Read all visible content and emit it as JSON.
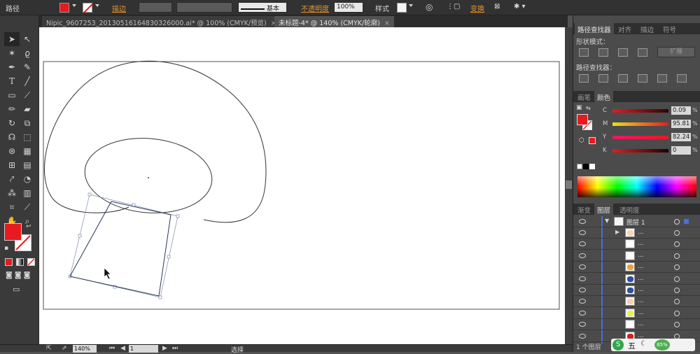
{
  "control_bar": {
    "selection_type": "路径",
    "stroke_label": "描边",
    "stroke_profile": "基本",
    "opacity_label": "不透明度",
    "opacity_value": "100%",
    "style_label": "样式",
    "transform_label": "变换",
    "fill_color": "#e8191f"
  },
  "document_tabs": [
    {
      "title": "Nipic_9607253_20130516164830326000.ai* @ 100% (CMYK/预览)",
      "close": "×"
    },
    {
      "title": "未标题-4* @ 140% (CMYK/轮廓)",
      "close": "×"
    }
  ],
  "toolbar": {
    "fill_color": "#e8191f",
    "tools": [
      "selection-tool",
      "direct-selection-tool",
      "magic-wand-tool",
      "lasso-tool",
      "pen-tool",
      "curvature-tool",
      "type-tool",
      "line-tool",
      "rectangle-tool",
      "paintbrush-tool",
      "pencil-tool",
      "eraser-tool",
      "rotate-tool",
      "scale-tool",
      "warp-tool",
      "free-transform-tool",
      "shape-builder-tool",
      "perspective-grid-tool",
      "mesh-tool",
      "gradient-tool",
      "eyedropper-tool",
      "blend-tool",
      "symbol-sprayer-tool",
      "column-graph-tool",
      "artboard-tool",
      "slice-tool",
      "hand-tool",
      "zoom-tool"
    ]
  },
  "status_bar": {
    "zoom": "140%",
    "artboard": "1",
    "tool_name": "选择"
  },
  "pathfinder_panel": {
    "tabs": [
      "路径查找器",
      "对齐",
      "描边",
      "符号"
    ],
    "shape_modes_label": "形状模式：",
    "expand_button": "扩展",
    "pathfinders_label": "路径查找器："
  },
  "color_panel": {
    "tabs": [
      "画笔",
      "颜色"
    ],
    "channels": [
      {
        "name": "C",
        "value": "0.09",
        "unit": "%"
      },
      {
        "name": "M",
        "value": "95.81",
        "unit": "%"
      },
      {
        "name": "Y",
        "value": "82.24",
        "unit": "%"
      },
      {
        "name": "K",
        "value": "0",
        "unit": "%"
      }
    ],
    "fill_color": "#e8191f"
  },
  "layers_panel": {
    "tabs": [
      "渐变",
      "图层",
      "透明度"
    ],
    "layer_name": "图层 1",
    "sublayer_label": "...",
    "layer_count": "1 个图层",
    "sublayer_thumbs": [
      "#f4d6b4",
      "#ffffff",
      "#ffffff",
      "#e8a23a",
      "#2d4fa0",
      "#2d4fa0",
      "#f6d0b0",
      "#e9f050",
      "#ffffff",
      "#cc2222"
    ]
  },
  "ime_bar": {
    "label": "五",
    "battery": "65%"
  }
}
